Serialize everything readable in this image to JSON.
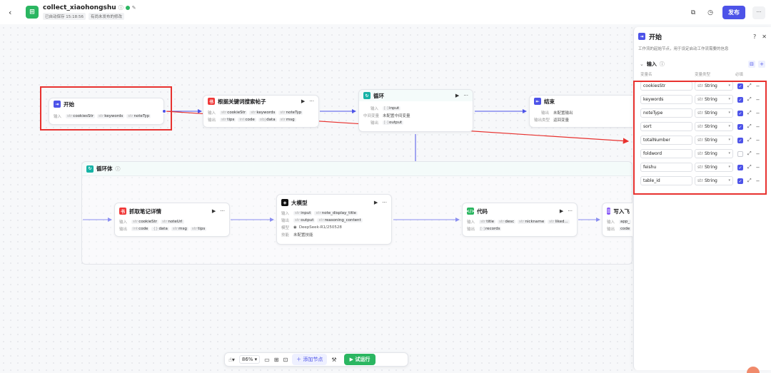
{
  "header": {
    "back": "‹",
    "title": "collect_xiaohongshu",
    "saved": "已自动保存 15:18:56",
    "unpublished": "有尚未发布的修改",
    "publish_label": "发布",
    "more_label": "···"
  },
  "nodes": {
    "start": {
      "title": "开始",
      "in_label": "输入",
      "inputs": [
        "cookiesStr",
        "keywords",
        "noteTyp"
      ]
    },
    "search": {
      "title": "根据关键词搜索帖子",
      "in_label": "输入",
      "out_label": "输出",
      "inputs": [
        "cookieStr",
        "keywords",
        "noteTyp"
      ],
      "outputs": [
        "tips",
        "code",
        "data",
        "msg"
      ]
    },
    "loop": {
      "title": "循环",
      "in_label": "输入",
      "in_value": "input",
      "mid_label": "中间变量",
      "mid_value": "未配置中间变量",
      "out_label": "输出",
      "out_value": "output"
    },
    "end": {
      "title": "结束",
      "out_label": "输出",
      "out_value": "未配置输出",
      "return_label": "输出类型",
      "return_value": "返回变量"
    },
    "loop_body": {
      "title": "循环体"
    },
    "detail": {
      "title": "抓取笔记详情",
      "in_label": "输入",
      "out_label": "输出",
      "inputs": [
        "cookieStr",
        "noteUrl"
      ],
      "outputs": [
        "code",
        "data",
        "msg",
        "tips"
      ]
    },
    "llm": {
      "title": "大模型",
      "in_label": "输入",
      "out_label": "输出",
      "model_label": "模型",
      "skill_label": "技能",
      "inputs": [
        "input",
        "note_display_title"
      ],
      "outputs": [
        "output",
        "reasoning_content"
      ],
      "model": "DeepSeek-R1/250528",
      "skill": "未配置技能"
    },
    "code": {
      "title": "代码",
      "in_label": "输入",
      "out_label": "输出",
      "inputs": [
        "title",
        "desc",
        "nickname",
        "liked..."
      ],
      "outputs": [
        "records"
      ]
    },
    "write": {
      "title": "写入飞",
      "in_label": "输入",
      "out_label": "输出",
      "inputs": [
        "app_"
      ],
      "outputs": [
        "code"
      ]
    }
  },
  "toolbar": {
    "zoom": "86%",
    "add_node": "添加节点",
    "run": "试运行"
  },
  "panel": {
    "title": "开始",
    "description": "工作流的起始节点，用于设定启动工作流需要的信息",
    "section": "输入",
    "col_name": "变量名",
    "col_type": "变量类型",
    "col_required": "必填",
    "variables": [
      {
        "name": "cookiesStr",
        "type": "String",
        "required": true
      },
      {
        "name": "keywords",
        "type": "String",
        "required": true
      },
      {
        "name": "noteType",
        "type": "String",
        "required": true
      },
      {
        "name": "sort",
        "type": "String",
        "required": true
      },
      {
        "name": "totalNumber",
        "type": "String",
        "required": true
      },
      {
        "name": "foldword",
        "type": "String",
        "required": false
      },
      {
        "name": "feishu",
        "type": "String",
        "required": true
      },
      {
        "name": "table_id",
        "type": "String",
        "required": true
      }
    ]
  },
  "colors": {
    "accent": "#4d53e8",
    "annotation": "#e8322f",
    "run": "#2bb661"
  },
  "icons": {
    "type_prefix": "str",
    "check": "✓"
  }
}
